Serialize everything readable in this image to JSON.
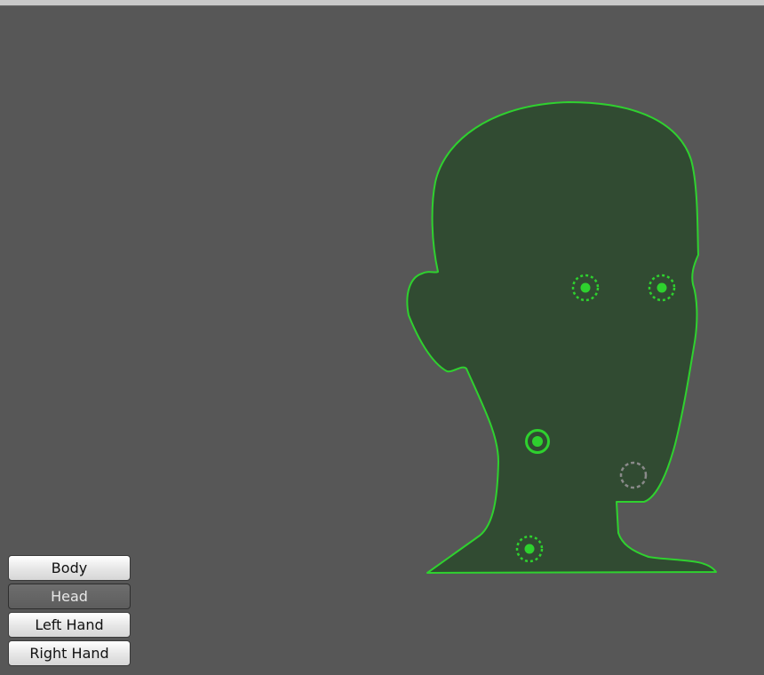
{
  "colors": {
    "background": "#575757",
    "head_fill": "#314b32",
    "head_outline": "#2fd12f",
    "point_active": "#2ed12e",
    "point_inactive": "#8a8a8a"
  },
  "tracking_points": [
    {
      "name": "left-eye-point",
      "state": "dotted"
    },
    {
      "name": "right-eye-point",
      "state": "dotted"
    },
    {
      "name": "neck-point",
      "state": "selected"
    },
    {
      "name": "jaw-point",
      "state": "inactive"
    },
    {
      "name": "base-point",
      "state": "dotted"
    }
  ],
  "part_selector": {
    "selected": "Head",
    "buttons": [
      {
        "label": "Body"
      },
      {
        "label": "Head"
      },
      {
        "label": "Left Hand"
      },
      {
        "label": "Right Hand"
      }
    ]
  }
}
